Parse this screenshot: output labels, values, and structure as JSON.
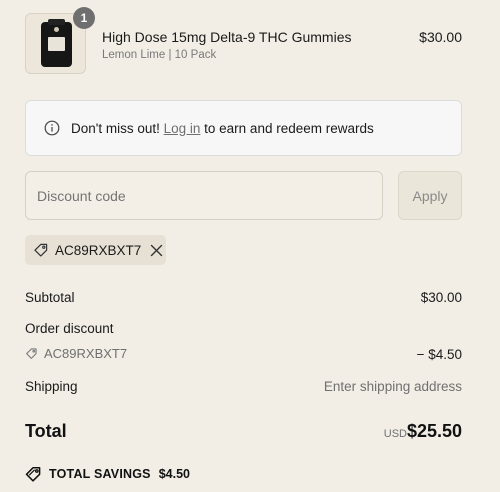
{
  "product": {
    "quantity": "1",
    "name": "High Dose 15mg Delta-9 THC Gummies",
    "variant": "Lemon Lime | 10 Pack",
    "price": "$30.00"
  },
  "rewards_banner": {
    "prefix": "Don't miss out! ",
    "link": "Log in",
    "suffix": " to earn and redeem rewards"
  },
  "discount": {
    "placeholder": "Discount code",
    "value": "",
    "apply_label": "Apply",
    "applied_code": "AC89RXBXT7"
  },
  "summary": {
    "subtotal_label": "Subtotal",
    "subtotal_value": "$30.00",
    "order_discount_label": "Order discount",
    "discount_code": "AC89RXBXT7",
    "discount_value": "− $4.50",
    "shipping_label": "Shipping",
    "shipping_value": "Enter shipping address",
    "total_label": "Total",
    "total_currency": "USD",
    "total_value": "$25.50",
    "savings_label": "TOTAL SAVINGS",
    "savings_value": "$4.50"
  },
  "colors": {
    "background": "#f2eee6",
    "badge": "#6f6f6f",
    "muted_text": "#707070"
  }
}
